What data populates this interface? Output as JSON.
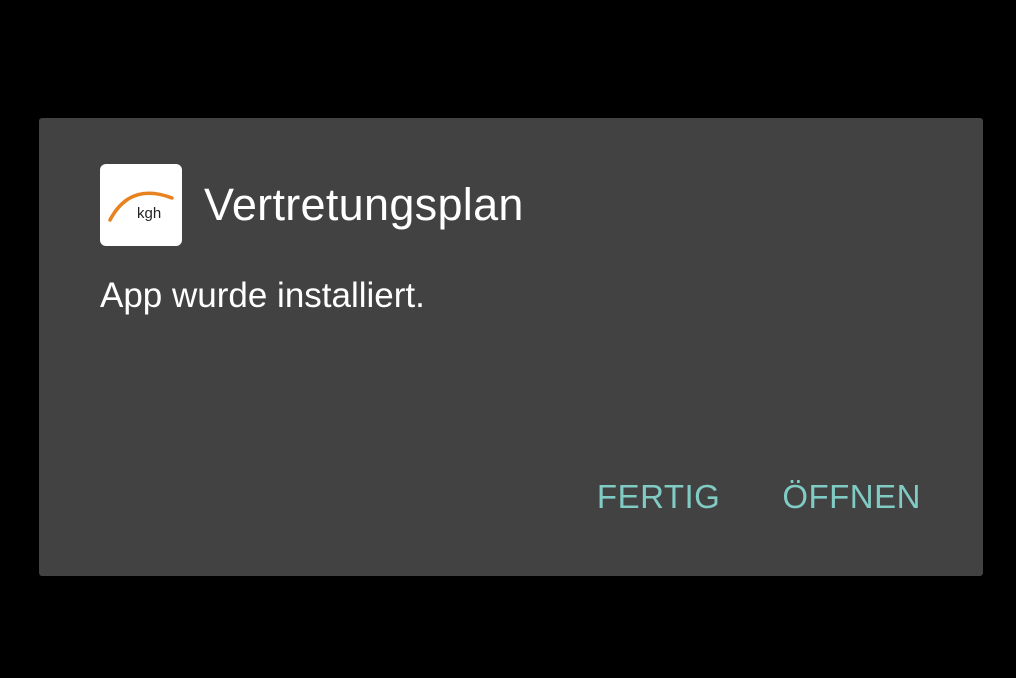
{
  "dialog": {
    "app_icon": {
      "icon_name": "kgh-logo-icon",
      "logo_text": "kgh",
      "arc_color": "#e8821f"
    },
    "app_title": "Vertretungsplan",
    "message": "App wurde installiert.",
    "buttons": {
      "done_label": "FERTIG",
      "open_label": "ÖFFNEN"
    }
  },
  "colors": {
    "background": "#000000",
    "dialog_background": "#424242",
    "text": "#ffffff",
    "accent": "#80cbc4"
  }
}
